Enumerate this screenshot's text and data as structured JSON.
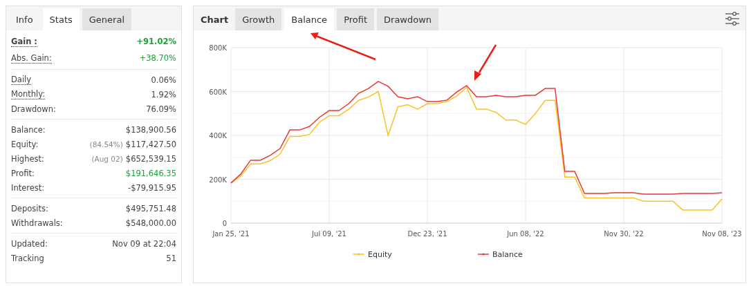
{
  "stats_panel": {
    "title": "Info",
    "tabs": [
      {
        "label": "Stats",
        "selected": true
      },
      {
        "label": "General",
        "selected": false
      }
    ],
    "sections": [
      {
        "rows": [
          {
            "label": "Gain :",
            "value": "+91.02%",
            "tooltip": true,
            "bold": true,
            "positive": true
          },
          {
            "label": "Abs. Gain:",
            "value": "+38.70%",
            "tooltip": true,
            "bold": false,
            "positive": true
          }
        ]
      },
      {
        "rows": [
          {
            "label": "Daily",
            "value": "0.06%",
            "tooltip": true,
            "bold": false,
            "positive": false
          },
          {
            "label": "Monthly:",
            "value": "1.92%",
            "tooltip": true,
            "bold": false,
            "positive": false
          },
          {
            "label": "Drawdown:",
            "value": "76.09%",
            "tooltip": false,
            "bold": false,
            "positive": false
          }
        ]
      },
      {
        "rows": [
          {
            "label": "Balance:",
            "value": "$138,900.56",
            "tooltip": false,
            "bold": false,
            "positive": false
          },
          {
            "label": "Equity:",
            "note": "(84.54%)",
            "value": "$117,427.50",
            "tooltip": false,
            "bold": false,
            "positive": false
          },
          {
            "label": "Highest:",
            "note": "(Aug 02)",
            "value": "$652,539.15",
            "tooltip": false,
            "bold": false,
            "positive": false
          },
          {
            "label": "Profit:",
            "value": "$191,646.35",
            "tooltip": false,
            "bold": false,
            "positive": true
          },
          {
            "label": "Interest:",
            "value": "-$79,915.95",
            "tooltip": false,
            "bold": false,
            "positive": false
          }
        ]
      },
      {
        "rows": [
          {
            "label": "Deposits:",
            "value": "$495,751.48",
            "tooltip": false,
            "bold": false,
            "positive": false
          },
          {
            "label": "Withdrawals:",
            "value": "$548,000.00",
            "tooltip": false,
            "bold": false,
            "positive": false
          }
        ]
      },
      {
        "rows": [
          {
            "label": "Updated:",
            "value": "Nov 09 at 22:04",
            "tooltip": false,
            "bold": false,
            "positive": false
          },
          {
            "label": "Tracking",
            "value": "51",
            "tooltip": false,
            "bold": false,
            "positive": false
          }
        ]
      }
    ]
  },
  "chart_panel": {
    "title": "Chart",
    "tabs": [
      {
        "label": "Growth",
        "selected": false,
        "arrow": false
      },
      {
        "label": "Balance",
        "selected": true,
        "arrow": true
      },
      {
        "label": "Profit",
        "selected": false,
        "arrow": false
      },
      {
        "label": "Drawdown",
        "selected": false,
        "arrow": false
      }
    ],
    "chart_arrow": true,
    "chart_data": {
      "type": "line",
      "grid": true,
      "legend": true,
      "categories": [
        "Jan 25, '21",
        null,
        null,
        null,
        null,
        null,
        null,
        null,
        null,
        null,
        "Jul 09, '21",
        null,
        null,
        null,
        null,
        null,
        null,
        null,
        null,
        null,
        "Dec 23, '21",
        null,
        null,
        null,
        null,
        null,
        null,
        null,
        null,
        null,
        "Jun 08, '22",
        null,
        null,
        null,
        null,
        null,
        null,
        null,
        null,
        null,
        "Nov 30, '22",
        null,
        null,
        null,
        null,
        null,
        null,
        null,
        null,
        null,
        "Nov 08, '23"
      ],
      "series": [
        {
          "name": "Equity",
          "color": "#f7c325",
          "values": [
            183000,
            215000,
            270000,
            270000,
            285000,
            315000,
            395000,
            395000,
            405000,
            460000,
            490000,
            490000,
            520000,
            560000,
            575000,
            600000,
            400000,
            530000,
            540000,
            520000,
            545000,
            545000,
            555000,
            580000,
            620000,
            520000,
            520000,
            505000,
            470000,
            470000,
            450000,
            500000,
            560000,
            560000,
            210000,
            210000,
            115000,
            115000,
            115000,
            115000,
            115000,
            115000,
            100000,
            100000,
            100000,
            100000,
            60000,
            60000,
            60000,
            60000,
            110000
          ]
        },
        {
          "name": "Balance",
          "color": "#e53935",
          "values": [
            183000,
            224000,
            287000,
            287000,
            309000,
            340000,
            425000,
            425000,
            441000,
            482000,
            513000,
            513000,
            545000,
            592000,
            614000,
            646000,
            624000,
            576000,
            567000,
            576000,
            554000,
            554000,
            561000,
            598000,
            627000,
            576000,
            576000,
            583000,
            576000,
            576000,
            583000,
            583000,
            614000,
            614000,
            236000,
            236000,
            135000,
            135000,
            135000,
            139000,
            139000,
            139000,
            132000,
            132000,
            132000,
            132000,
            135000,
            135000,
            135000,
            135000,
            139000
          ]
        }
      ],
      "ylim": [
        0,
        800000
      ],
      "yticks": [
        {
          "value": 0,
          "label": "0"
        },
        {
          "value": 200000,
          "label": "200K"
        },
        {
          "value": 400000,
          "label": "400K"
        },
        {
          "value": 600000,
          "label": "600K"
        },
        {
          "value": 800000,
          "label": "800K"
        }
      ]
    }
  }
}
